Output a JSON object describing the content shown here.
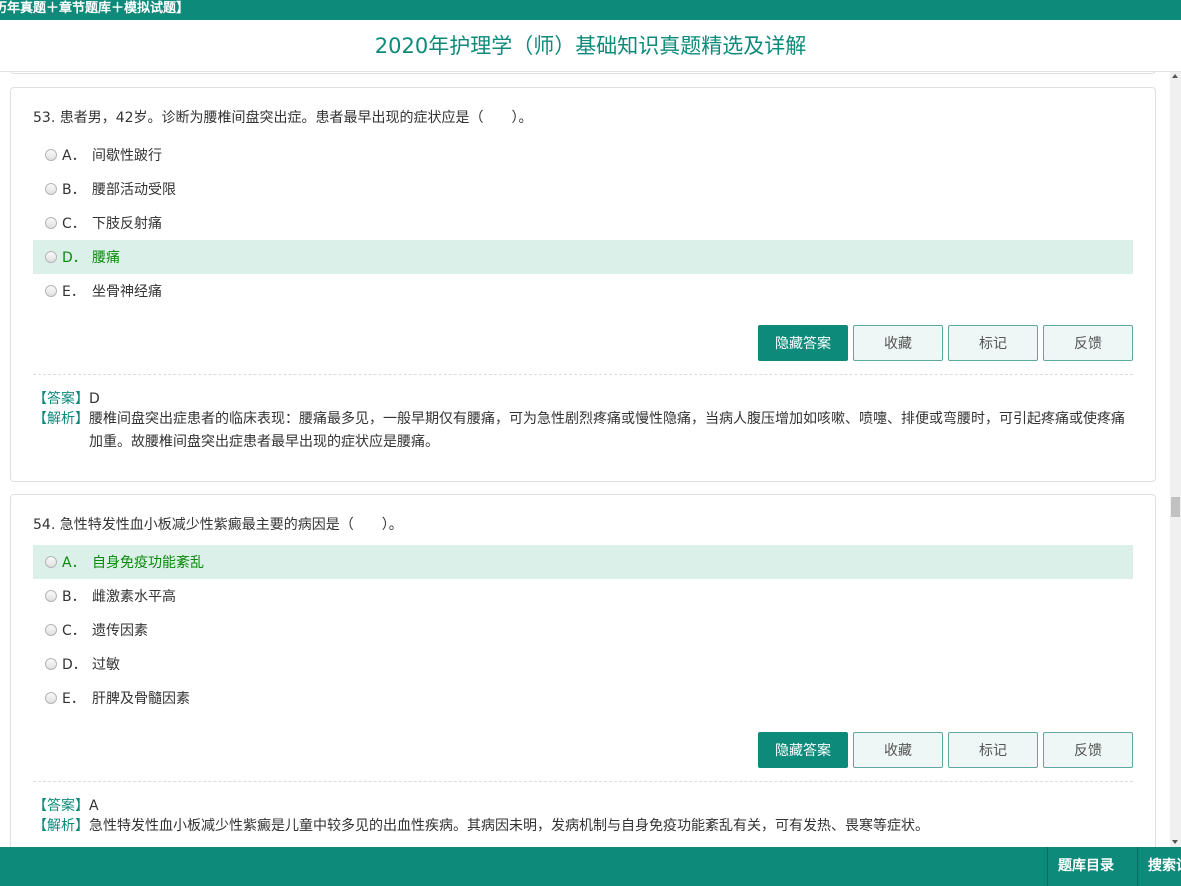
{
  "header": {
    "top_banner": "历年真题＋章节题库＋模拟试题】",
    "title": "2020年护理学（师）基础知识真题精选及详解"
  },
  "questions": [
    {
      "stem": "53. 患者男，42岁。诊断为腰椎间盘突出症。患者最早出现的症状应是（　　）。",
      "options": [
        {
          "letter": "A．",
          "text": "间歇性跛行"
        },
        {
          "letter": "B．",
          "text": "腰部活动受限"
        },
        {
          "letter": "C．",
          "text": "下肢反射痛"
        },
        {
          "letter": "D．",
          "text": "腰痛"
        },
        {
          "letter": "E．",
          "text": "坐骨神经痛"
        }
      ],
      "highlighted_option": "D",
      "answer_label": "【答案】",
      "answer": "D",
      "analysis_label": "【解析】",
      "analysis": "腰椎间盘突出症患者的临床表现：腰痛最多见，一般早期仅有腰痛，可为急性剧烈疼痛或慢性隐痛，当病人腹压增加如咳嗽、喷嚏、排便或弯腰时，可引起疼痛或使疼痛加重。故腰椎间盘突出症患者最早出现的症状应是腰痛。"
    },
    {
      "stem": "54. 急性特发性血小板减少性紫癜最主要的病因是（　　）。",
      "options": [
        {
          "letter": "A．",
          "text": "自身免疫功能紊乱"
        },
        {
          "letter": "B．",
          "text": "雌激素水平高"
        },
        {
          "letter": "C．",
          "text": "遗传因素"
        },
        {
          "letter": "D．",
          "text": "过敏"
        },
        {
          "letter": "E．",
          "text": "肝脾及骨髓因素"
        }
      ],
      "highlighted_option": "A",
      "answer_label": "【答案】",
      "answer": "A",
      "analysis_label": "【解析】",
      "analysis": "急性特发性血小板减少性紫癜是儿童中较多见的出血性疾病。其病因未明，发病机制与自身免疫功能紊乱有关，可有发热、畏寒等症状。"
    }
  ],
  "buttons": {
    "hide_answer": "隐藏答案",
    "favorite": "收藏",
    "mark": "标记",
    "feedback": "反馈"
  },
  "footer": {
    "catalog": "题库目录",
    "search": "搜索试"
  },
  "colors": {
    "accent": "#0d8a7a",
    "highlight_bg": "#dcf0ea",
    "correct_text": "#0a8a0a"
  }
}
